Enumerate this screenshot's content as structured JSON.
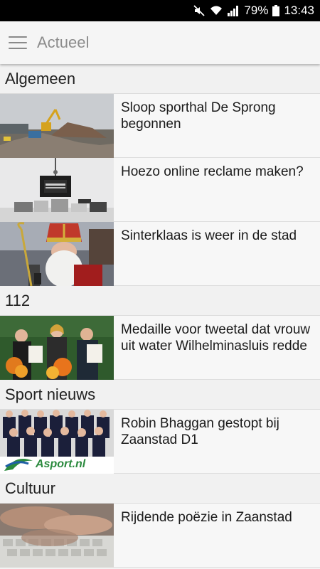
{
  "status_bar": {
    "battery": "79%",
    "time": "13:43",
    "icons": [
      "mute-icon",
      "wifi-icon",
      "signal-icon",
      "battery-icon"
    ]
  },
  "app_bar": {
    "title": "Actueel",
    "menu_icon": "hamburger-menu-icon"
  },
  "sections": [
    {
      "title": "Algemeen",
      "articles": [
        {
          "headline": "Sloop sporthal De Sprong begonnen",
          "thumbnail": "demolition-excavator"
        },
        {
          "headline": "Hoezo online reclame maken?",
          "thumbnail": "old-computers-monitor"
        },
        {
          "headline": "Sinterklaas is weer in de stad",
          "thumbnail": "sinterklaas-mitre"
        }
      ]
    },
    {
      "title": "112",
      "articles": [
        {
          "headline": "Medaille voor tweetal dat vrouw uit water Wilhelminasluis redde",
          "thumbnail": "people-with-flowers-certificates"
        }
      ]
    },
    {
      "title": "Sport nieuws",
      "articles": [
        {
          "headline": "Robin Bhaggan gestopt bij Zaanstad D1",
          "thumbnail": "volleyball-team-photo",
          "thumbnail_text": "Asport.nl"
        }
      ]
    },
    {
      "title": "Cultuur",
      "articles": [
        {
          "headline": "Rijdende poëzie in Zaanstad",
          "thumbnail": "hands-on-keyboard"
        }
      ]
    }
  ],
  "colors": {
    "status_bar_bg": "#000000",
    "app_bar_bg": "#f5f5f5",
    "title_color": "#8c8c8c",
    "list_bg": "#f7f7f7"
  }
}
